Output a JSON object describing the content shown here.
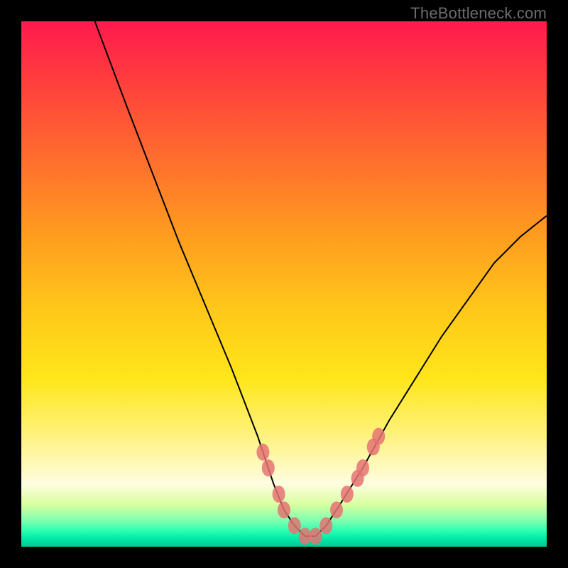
{
  "watermark": "TheBottleneck.com",
  "chart_data": {
    "type": "line",
    "title": "",
    "xlabel": "",
    "ylabel": "",
    "xlim": [
      0,
      100
    ],
    "ylim": [
      0,
      100
    ],
    "series": [
      {
        "name": "curve",
        "x": [
          14,
          20,
          25,
          30,
          35,
          40,
          45,
          48,
          50,
          52,
          54,
          56,
          58,
          60,
          65,
          70,
          75,
          80,
          85,
          90,
          95,
          100
        ],
        "y": [
          100,
          84,
          71,
          58,
          46,
          34,
          21,
          12,
          7,
          4,
          2,
          2,
          4,
          7,
          15,
          24,
          32,
          40,
          47,
          54,
          59,
          63
        ]
      },
      {
        "name": "markers",
        "x": [
          46,
          47,
          49,
          50,
          52,
          54,
          56,
          58,
          60,
          62,
          64,
          65,
          67,
          68
        ],
        "y": [
          18,
          15,
          10,
          7,
          4,
          2,
          2,
          4,
          7,
          10,
          13,
          15,
          19,
          21
        ]
      }
    ]
  }
}
